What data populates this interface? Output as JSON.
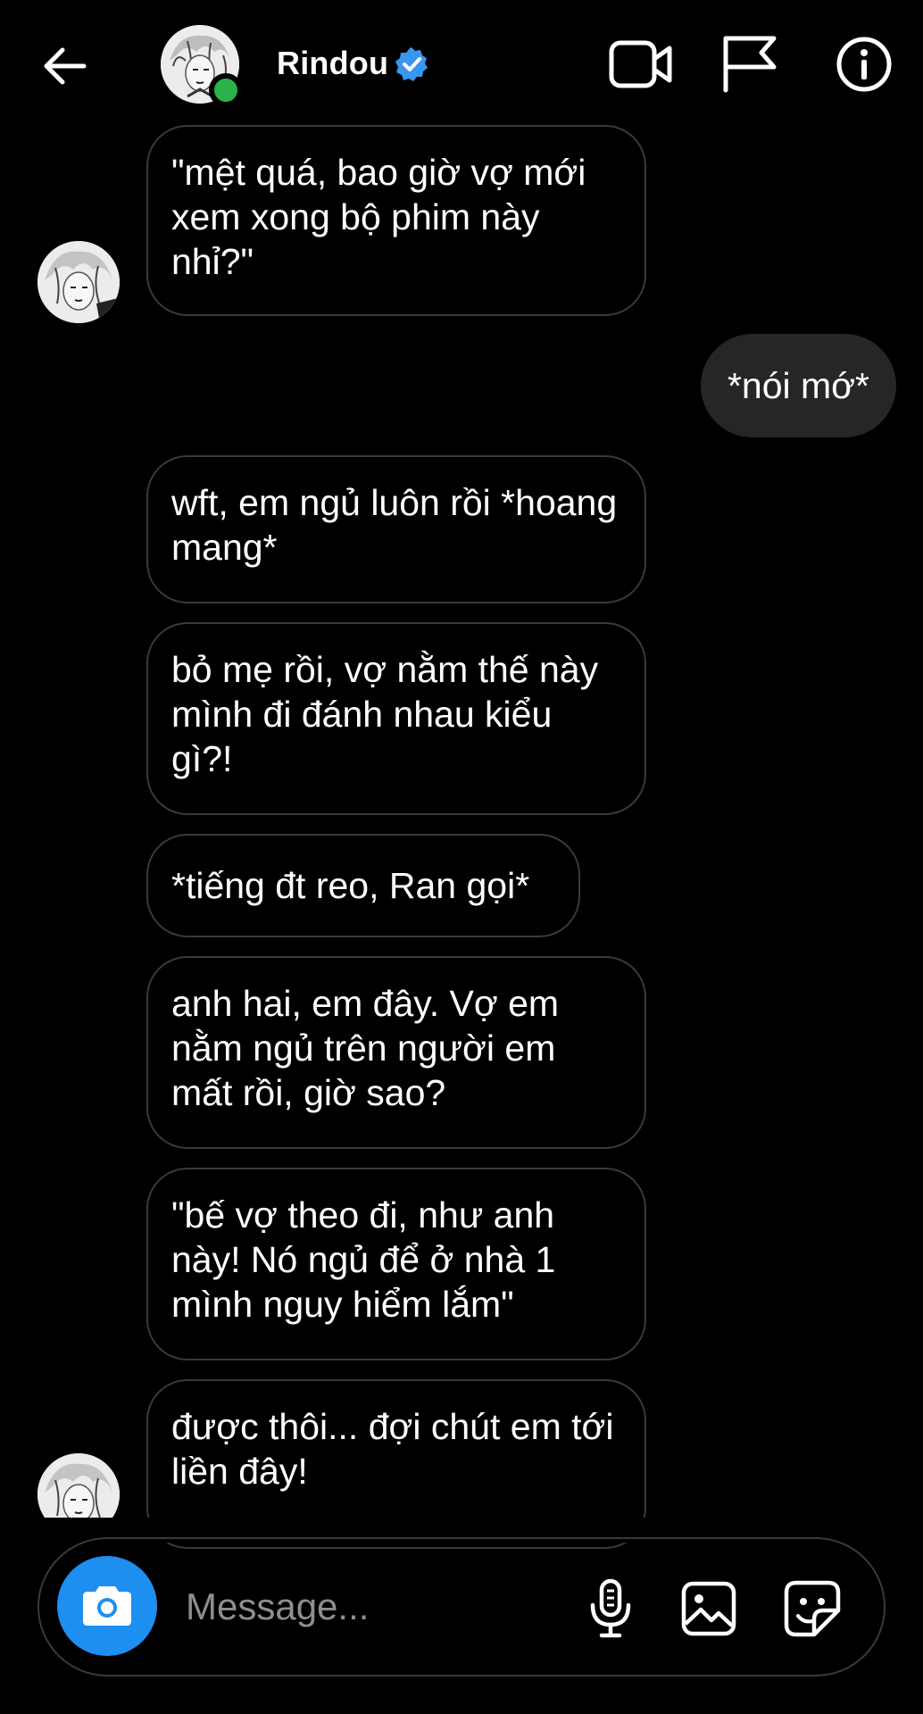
{
  "header": {
    "name": "Rindou",
    "verified": true,
    "online": true
  },
  "messages": [
    {
      "direction": "in",
      "text": "\"mệt quá, bao giờ vợ mới xem xong bộ phim này nhỉ?\""
    },
    {
      "direction": "out",
      "text": "*nói mớ*"
    },
    {
      "direction": "in",
      "text": "wft, em ngủ luôn rồi *hoang mang*"
    },
    {
      "direction": "in",
      "text": "bỏ mẹ rồi, vợ nằm thế này mình đi đánh nhau kiểu gì?!"
    },
    {
      "direction": "in",
      "text": "*tiếng đt reo, Ran gọi*"
    },
    {
      "direction": "in",
      "text": "anh hai, em đây. Vợ em nằm ngủ trên người em mất rồi, giờ sao?"
    },
    {
      "direction": "in",
      "text": "\"bế vợ theo đi, như anh này! Nó ngủ để ở nhà 1 mình nguy hiểm lắm\""
    },
    {
      "direction": "in",
      "text": "được thôi... đợi chút em tới liền đây!"
    }
  ],
  "composer": {
    "placeholder": "Message..."
  },
  "colors": {
    "background": "#000000",
    "accent": "#1d8ff0",
    "online": "#2bb34a",
    "verified": "#3897f0",
    "outgoing_bubble": "#262626",
    "bubble_border": "#3a3a3a"
  },
  "icons": [
    "back-arrow-icon",
    "video-call-icon",
    "flag-icon",
    "info-icon",
    "camera-icon",
    "microphone-icon",
    "gallery-icon",
    "sticker-icon",
    "verified-badge-icon"
  ]
}
